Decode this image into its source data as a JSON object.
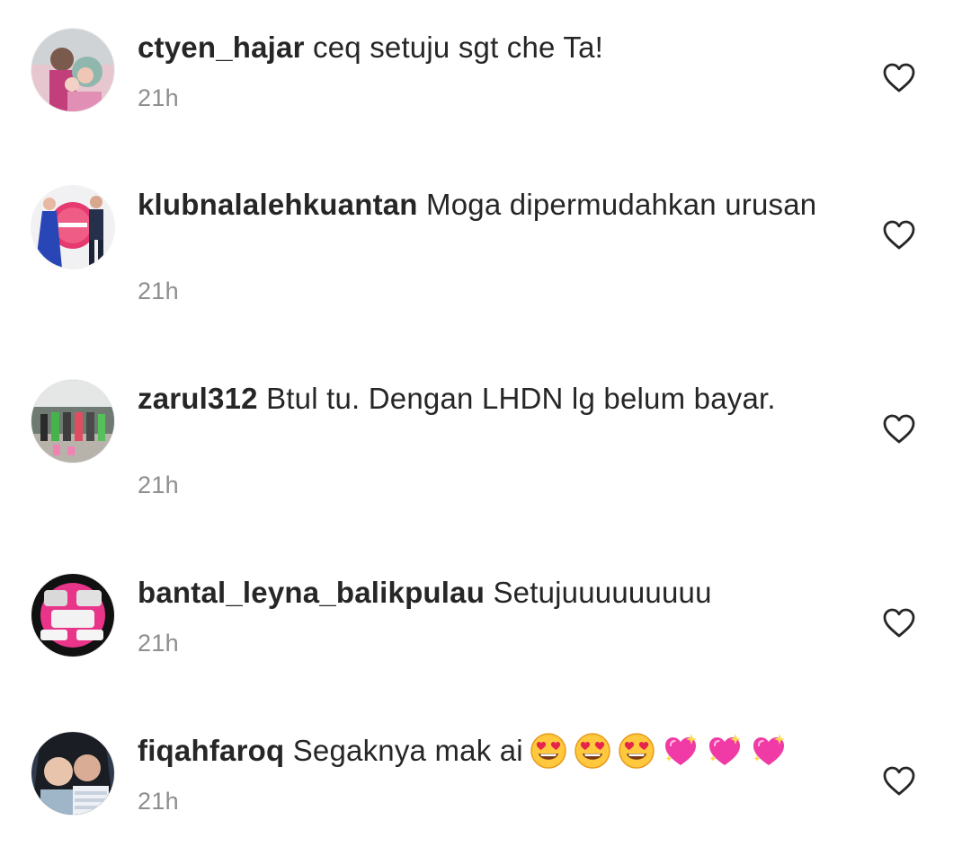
{
  "colors": {
    "text": "#262626",
    "secondary_text": "#8e8e8e",
    "background": "#ffffff"
  },
  "comments": [
    {
      "username": "ctyen_hajar",
      "text": "ceq setuju sgt che Ta!",
      "time": "21h",
      "avatar_icon": "profile-photo"
    },
    {
      "username": "klubnalalehkuantan",
      "text": "Moga dipermudahkan urusan",
      "time": "21h",
      "avatar_icon": "profile-photo"
    },
    {
      "username": "zarul312",
      "text": "Btul tu. Dengan LHDN lg belum bayar.",
      "time": "21h",
      "avatar_icon": "profile-photo"
    },
    {
      "username": "bantal_leyna_balikpulau",
      "text": "Setujuuuuuuuuu",
      "time": "21h",
      "avatar_icon": "profile-photo"
    },
    {
      "username": "fiqahfaroq",
      "text": "Segaknya mak ai",
      "emojis": [
        "heart-eyes-emoji",
        "heart-eyes-emoji",
        "heart-eyes-emoji",
        "sparkling-heart-emoji",
        "sparkling-heart-emoji",
        "sparkling-heart-emoji"
      ],
      "time": "21h",
      "avatar_icon": "profile-photo"
    }
  ],
  "icons": {
    "like": "heart-outline-icon"
  }
}
